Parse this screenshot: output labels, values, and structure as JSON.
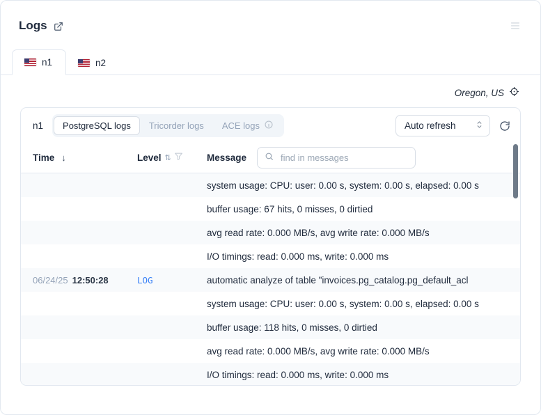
{
  "page": {
    "title": "Logs"
  },
  "tabs": [
    {
      "label": "n1"
    },
    {
      "label": "n2"
    }
  ],
  "region": {
    "label": "Oregon, US"
  },
  "toolbar": {
    "node_label": "n1",
    "segments": [
      {
        "label": "PostgreSQL logs"
      },
      {
        "label": "Tricorder logs"
      },
      {
        "label": "ACE logs"
      }
    ],
    "auto_refresh_label": "Auto refresh"
  },
  "table": {
    "columns": {
      "time": "Time",
      "level": "Level",
      "message": "Message"
    },
    "search_placeholder": "find in messages",
    "rows": [
      {
        "date": "",
        "time": "",
        "level": "",
        "message": "system usage: CPU: user: 0.00 s, system: 0.00 s, elapsed: 0.00 s"
      },
      {
        "date": "",
        "time": "",
        "level": "",
        "message": "buffer usage: 67 hits, 0 misses, 0 dirtied"
      },
      {
        "date": "",
        "time": "",
        "level": "",
        "message": "avg read rate: 0.000 MB/s, avg write rate: 0.000 MB/s"
      },
      {
        "date": "",
        "time": "",
        "level": "",
        "message": "I/O timings: read: 0.000 ms, write: 0.000 ms"
      },
      {
        "date": "06/24/25",
        "time": "12:50:28",
        "level": "LOG",
        "message": "automatic analyze of table \"invoices.pg_catalog.pg_default_acl"
      },
      {
        "date": "",
        "time": "",
        "level": "",
        "message": "system usage: CPU: user: 0.00 s, system: 0.00 s, elapsed: 0.00 s"
      },
      {
        "date": "",
        "time": "",
        "level": "",
        "message": "buffer usage: 118 hits, 0 misses, 0 dirtied"
      },
      {
        "date": "",
        "time": "",
        "level": "",
        "message": "avg read rate: 0.000 MB/s, avg write rate: 0.000 MB/s"
      },
      {
        "date": "",
        "time": "",
        "level": "",
        "message": "I/O timings: read: 0.000 ms, write: 0.000 ms"
      }
    ]
  },
  "colors": {
    "log_level_blue": "#3b82f6",
    "border": "#e2e8f0",
    "row_stripe": "#f8fafc"
  }
}
